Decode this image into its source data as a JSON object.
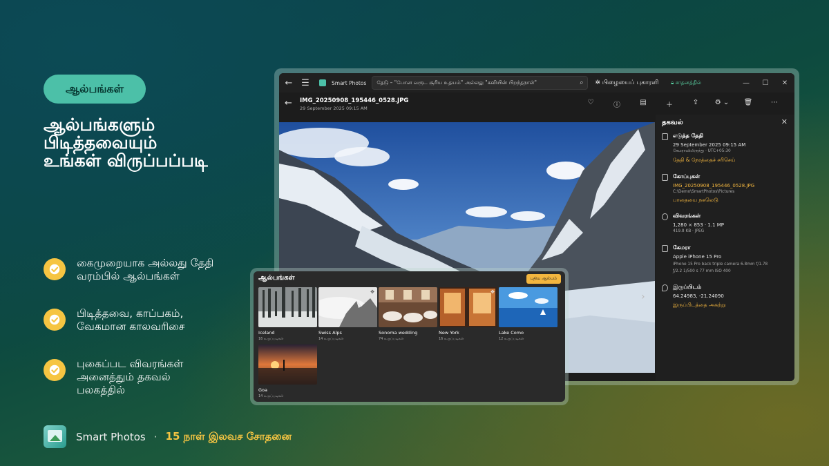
{
  "promo": {
    "pill": "ஆல்பங்கள்",
    "headline_lines": [
      "ஆல்பங்களும்",
      "பிடித்தவையும்",
      "உங்கள் விருப்பப்படி"
    ],
    "features": [
      {
        "line1": "கைமுறையாக அல்லது தேதி",
        "line2": "வரம்பில் ஆல்பங்கள்",
        "line3": ""
      },
      {
        "line1": "பிடித்தவை, காப்பகம்,",
        "line2": "வேகமான காலவரிசை",
        "line3": ""
      },
      {
        "line1": "புகைப்பட விவரங்கள்",
        "line2": "அனைத்தும் தகவல்",
        "line3": "பலகத்தில்"
      }
    ],
    "brand_name": "Smart Photos",
    "brand_sep": "·",
    "trial": "15 நாள் இலவச சோதனை"
  },
  "window": {
    "app_title": "Smart Photos",
    "search_text": "தேடு – \"போன வருட சூரிய உதயம்\" அல்லது \"கவியின் பிறந்தநாள்\"",
    "report": "பிழையைப் புகாரளி",
    "subscribed": "சாதனத்தில்",
    "file_name": "IMG_20250908_195446_0528.JPG",
    "file_date": "29 September 2025 09:15 AM"
  },
  "info": {
    "title": "தகவல்",
    "date_head": "எடுத்த தேதி",
    "date_value": "29 September 2025 09:15 AM",
    "date_tz": "கேமராவிலிருந்து · UTC+05:30",
    "date_link": "தேதி & நேரத்தைச் சரிசெய்",
    "file_head": "கோப்புகள்",
    "file_name": "IMG_20250908_195446_0528.JPG",
    "file_path": "C:\\Demo\\SmartPhotos\\Pictures",
    "file_link": "பாதையை நகலெடு",
    "details_head": "விவரங்கள்",
    "details_dims": "1,280 × 853 · 1.1 MP",
    "details_size": "419.8 KB · JPEG",
    "camera_head": "கேமரா",
    "camera_model": "Apple iPhone 15 Pro",
    "camera_lens": "iPhone 15 Pro back triple camera 6.8mm f/1.78",
    "camera_exif": "ƒ/2.2    1/500 s    77 mm    ISO 400",
    "loc_head": "இருப்பிடம்",
    "loc_coords": "64.24983, -21.24090",
    "loc_link": "இருப்பிடத்தை அகற்று"
  },
  "albums": {
    "title": "ஆல்பங்கள்",
    "new_album": "புதிய ஆல்பம்",
    "items": [
      {
        "name": "Iceland",
        "count": "16 உருப்படிகள்"
      },
      {
        "name": "Swiss Alps",
        "count": "14 உருப்படிகள்"
      },
      {
        "name": "Sonoma wedding",
        "count": "74 உருப்படிகள்"
      },
      {
        "name": "New York",
        "count": "16 உருப்படிகள்"
      },
      {
        "name": "Lake Como",
        "count": "12 உருப்படிகள்"
      },
      {
        "name": "Goa",
        "count": "14 உருப்படிகள்"
      }
    ]
  },
  "colors": {
    "accent_teal": "#4cc0a8",
    "accent_gold": "#f6c542",
    "link_orange": "#f3b63f"
  }
}
